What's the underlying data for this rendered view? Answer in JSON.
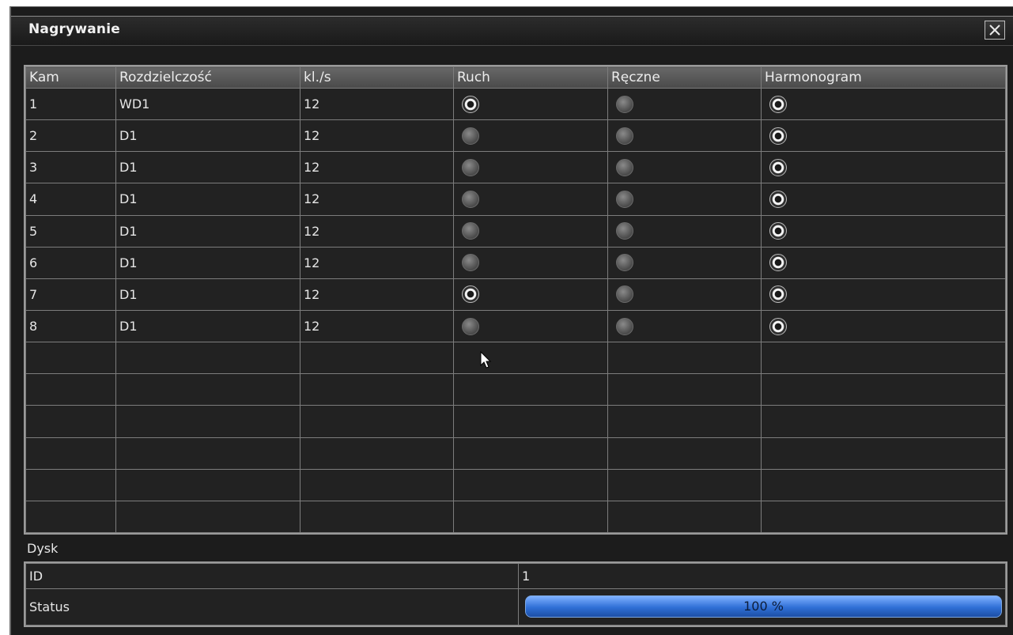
{
  "window": {
    "title": "Nagrywanie"
  },
  "table": {
    "headers": [
      "Kam",
      "Rozdzielczość",
      "kl./s",
      "Ruch",
      "Ręczne",
      "Harmonogram"
    ],
    "rows": [
      {
        "cam": "1",
        "resolution": "WD1",
        "fps": "12",
        "motion": true,
        "manual": false,
        "schedule": true
      },
      {
        "cam": "2",
        "resolution": "D1",
        "fps": "12",
        "motion": false,
        "manual": false,
        "schedule": true
      },
      {
        "cam": "3",
        "resolution": "D1",
        "fps": "12",
        "motion": false,
        "manual": false,
        "schedule": true
      },
      {
        "cam": "4",
        "resolution": "D1",
        "fps": "12",
        "motion": false,
        "manual": false,
        "schedule": true
      },
      {
        "cam": "5",
        "resolution": "D1",
        "fps": "12",
        "motion": false,
        "manual": false,
        "schedule": true
      },
      {
        "cam": "6",
        "resolution": "D1",
        "fps": "12",
        "motion": false,
        "manual": false,
        "schedule": true
      },
      {
        "cam": "7",
        "resolution": "D1",
        "fps": "12",
        "motion": true,
        "manual": false,
        "schedule": true
      },
      {
        "cam": "8",
        "resolution": "D1",
        "fps": "12",
        "motion": false,
        "manual": false,
        "schedule": true
      }
    ],
    "empty_rows": 6
  },
  "disk": {
    "section_label": "Dysk",
    "id_label": "ID",
    "id_value": "1",
    "status_label": "Status",
    "status_text": "100 %",
    "status_percent": 100
  }
}
